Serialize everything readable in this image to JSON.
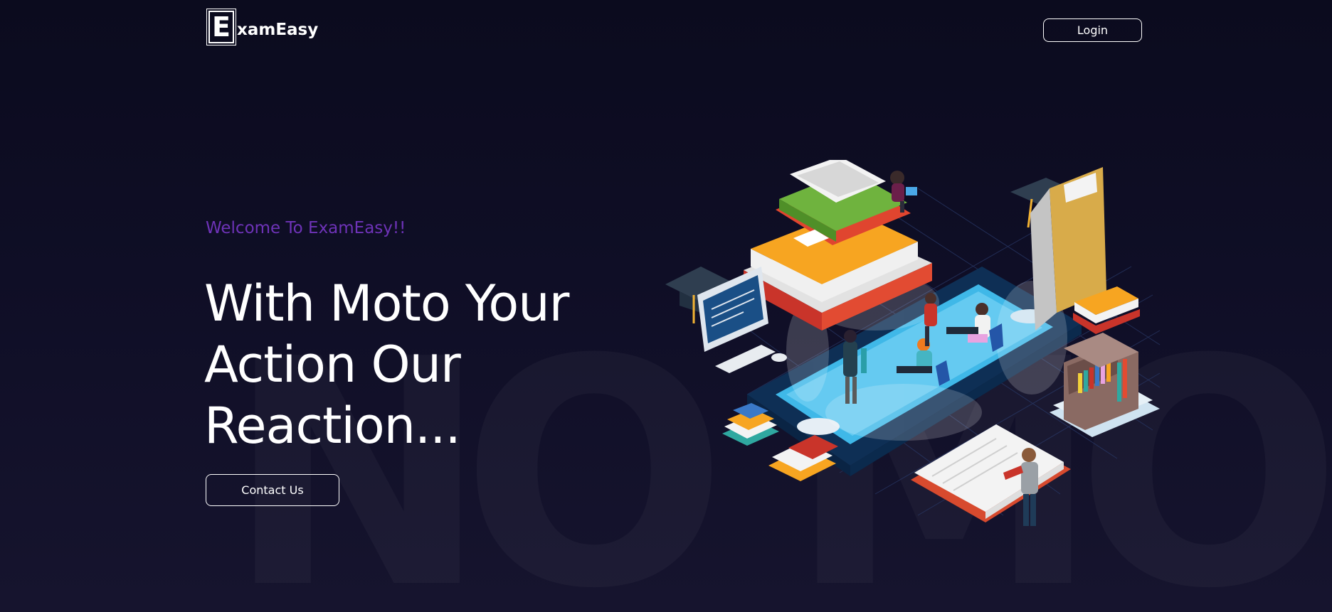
{
  "brand": {
    "logo_letter": "E",
    "logo_rest": "xamEasy",
    "accent_color": "#6e33b8",
    "background_color": "#0f0e26"
  },
  "header": {
    "login_label": "Login"
  },
  "hero": {
    "welcome": "Welcome To ExamEasy!!",
    "headline_lines": [
      "With Moto Your",
      "Action Our",
      "Reaction..."
    ],
    "contact_label": "Contact Us"
  },
  "watermark": {
    "letters": [
      "N",
      "O",
      "M",
      "O"
    ]
  },
  "illustration": {
    "icon": "isometric-study-illustration-icon"
  }
}
